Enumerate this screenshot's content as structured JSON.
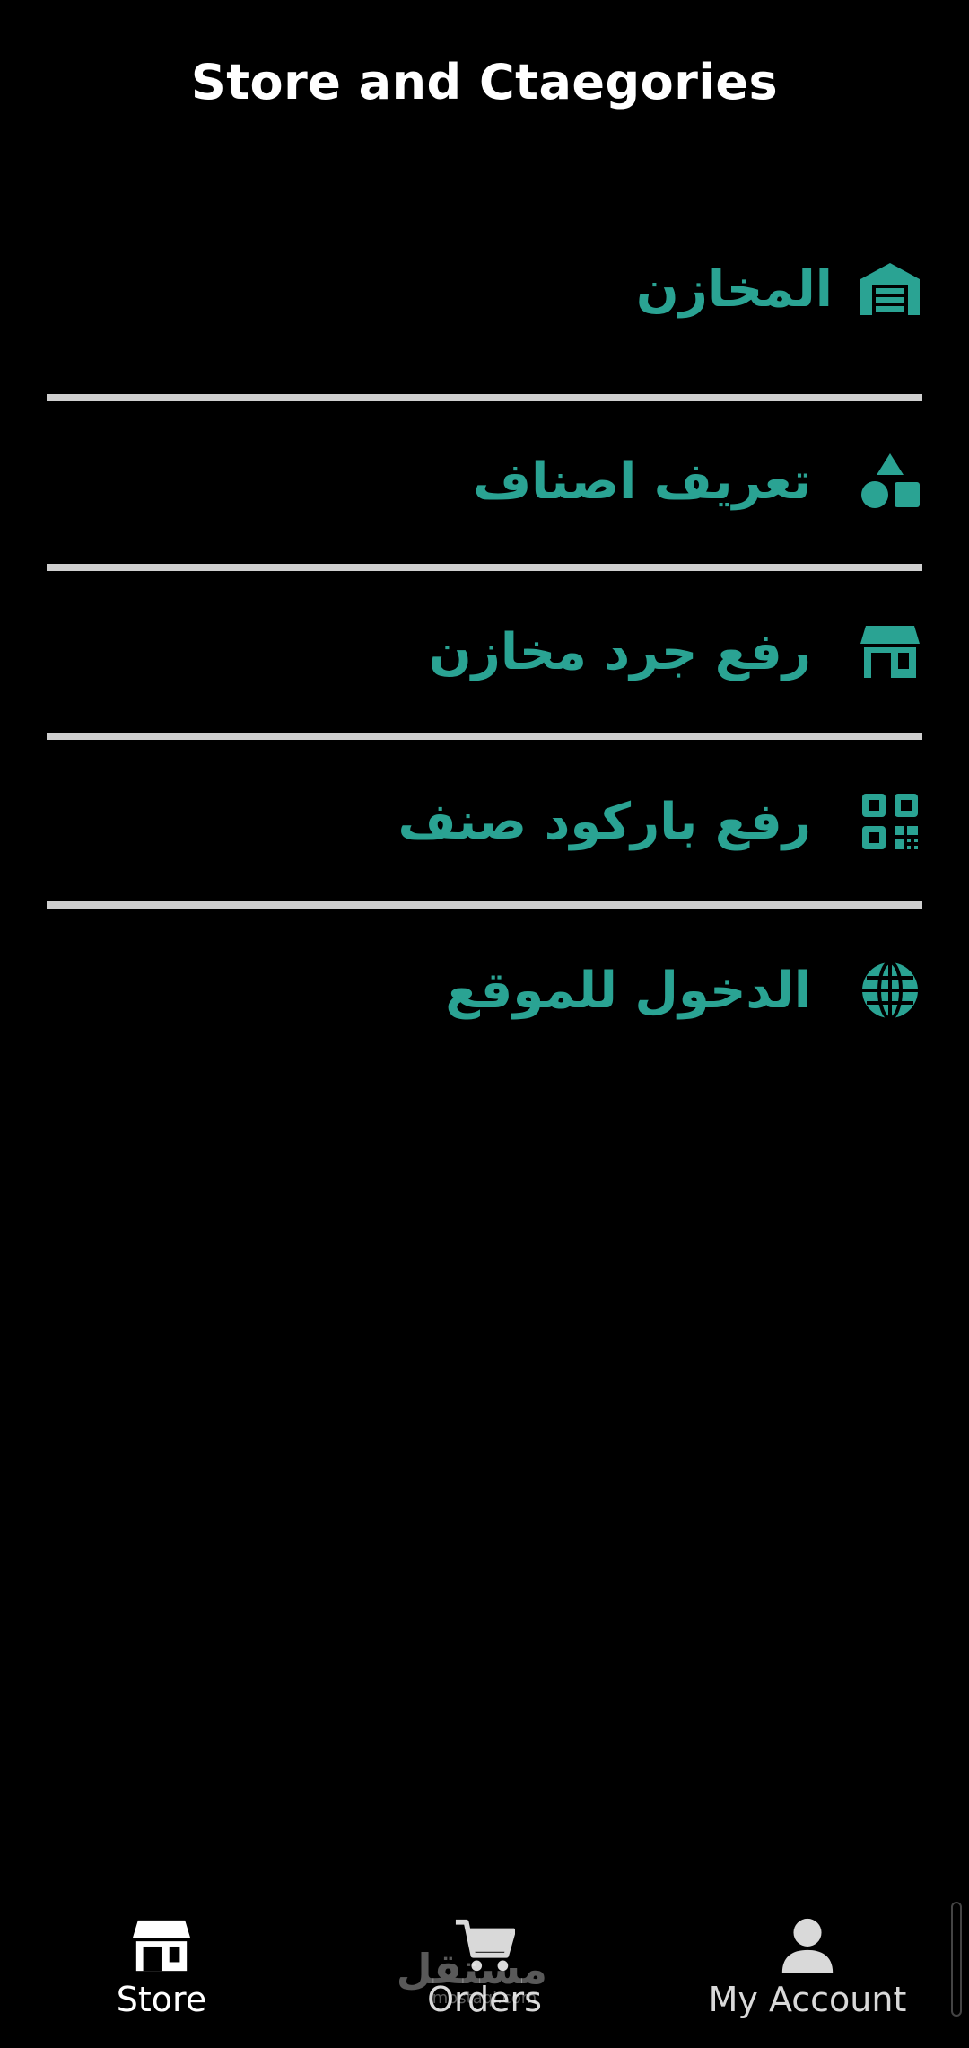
{
  "header": {
    "title": "Store and Ctaegories"
  },
  "menu": {
    "items": [
      {
        "label": "المخازن",
        "icon": "warehouse-icon"
      },
      {
        "label": "تعريف اصناف",
        "icon": "shapes-icon"
      },
      {
        "label": "رفع جرد مخازن",
        "icon": "store-icon"
      },
      {
        "label": "رفع باركود صنف",
        "icon": "qr-code-icon"
      },
      {
        "label": "الدخول للموقع",
        "icon": "globe-icon"
      }
    ]
  },
  "bottom_nav": {
    "items": [
      {
        "label": "Store",
        "icon": "store-icon",
        "active": true
      },
      {
        "label": "Orders",
        "icon": "cart-icon",
        "active": false
      },
      {
        "label": "My Account",
        "icon": "person-icon",
        "active": false
      }
    ]
  },
  "watermark": {
    "main": "مستقل",
    "sub": "mostaql.com"
  },
  "colors": {
    "background": "#000000",
    "accent": "#2aa393",
    "divider": "#cfcfcf",
    "text": "#ffffff"
  }
}
